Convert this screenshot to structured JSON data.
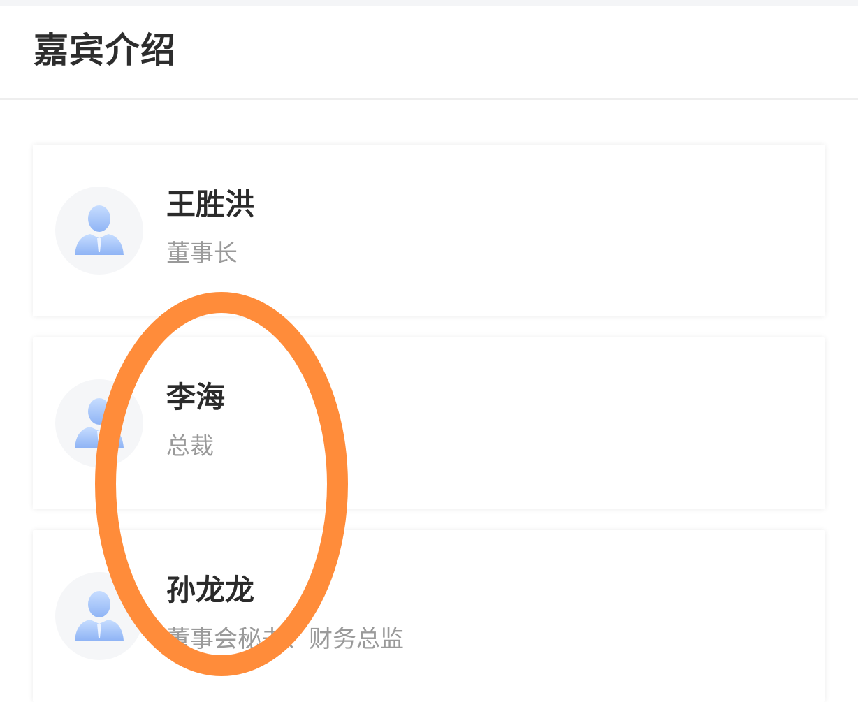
{
  "header": {
    "title": "嘉宾介绍"
  },
  "guests": [
    {
      "name": "王胜洪",
      "title": "董事长",
      "avatar_icon": "person-avatar-icon"
    },
    {
      "name": "李海",
      "title": "总裁",
      "avatar_icon": "person-avatar-icon"
    },
    {
      "name": "孙龙龙",
      "title": "董事会秘书、财务总监",
      "avatar_icon": "person-avatar-icon"
    }
  ],
  "colors": {
    "title_text": "#2d2d2d",
    "name_text": "#2b2b2b",
    "subtitle_text": "#9a9a9a",
    "avatar_bg": "#f5f6f8",
    "avatar_figure_light": "#bcd7ff",
    "avatar_figure_dark": "#8fb4f5",
    "annotation_stroke": "#ff8c3a"
  }
}
